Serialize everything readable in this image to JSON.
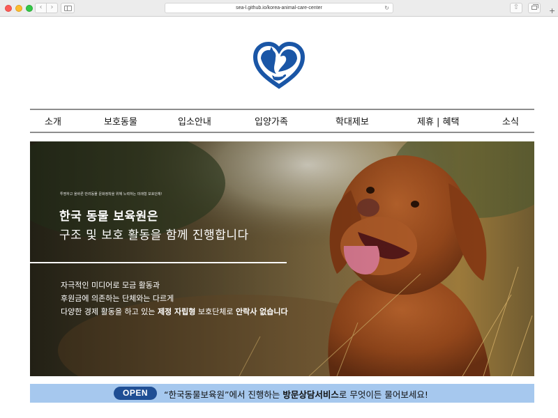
{
  "browser": {
    "url": "sea-l.github.io/korea-animal-care-center",
    "back_glyph": "‹",
    "forward_glyph": "›",
    "reload_glyph": "↻",
    "share_glyph": "⇧",
    "new_tab_glyph": "+"
  },
  "logo": {
    "icon": "heart-cat-dog-logo",
    "color": "#1a56a6"
  },
  "menu": {
    "items": [
      {
        "label": "소개"
      },
      {
        "label": "보호동물"
      },
      {
        "label": "입소안내"
      },
      {
        "label": "입양가족"
      },
      {
        "label": "학대제보"
      },
      {
        "label": "제휴 | 혜택"
      },
      {
        "label": "소식"
      }
    ]
  },
  "hero": {
    "small_text": "투명하고 올바른 반려동물 문화정착을 위해 노력하는 미래형 보호단체!",
    "title": "한국 동물 보육원은",
    "subtitle": "구조 및 보호 활동을 함께 진행합니다",
    "line1": "자극적인 미디어로 모금 활동과",
    "line2": "후원금에 의존하는 단체와는 다르게",
    "line3_pre": "다양한 경제 활동을 하고 있는 ",
    "line3_bold1": "제정 자립형",
    "line3_mid": " 보호단체로 ",
    "line3_bold2": "안락사 없습니다",
    "image_subject": "golden-brown-dog-photo"
  },
  "notice": {
    "badge": "OPEN",
    "text_pre": "“한국동물보육원”에서 진행하는 ",
    "text_bold": "방문상담서비스",
    "text_post": "로 무엇이든 물어보세요!",
    "background": "#a6c8ee",
    "badge_color": "#1f4e94"
  }
}
